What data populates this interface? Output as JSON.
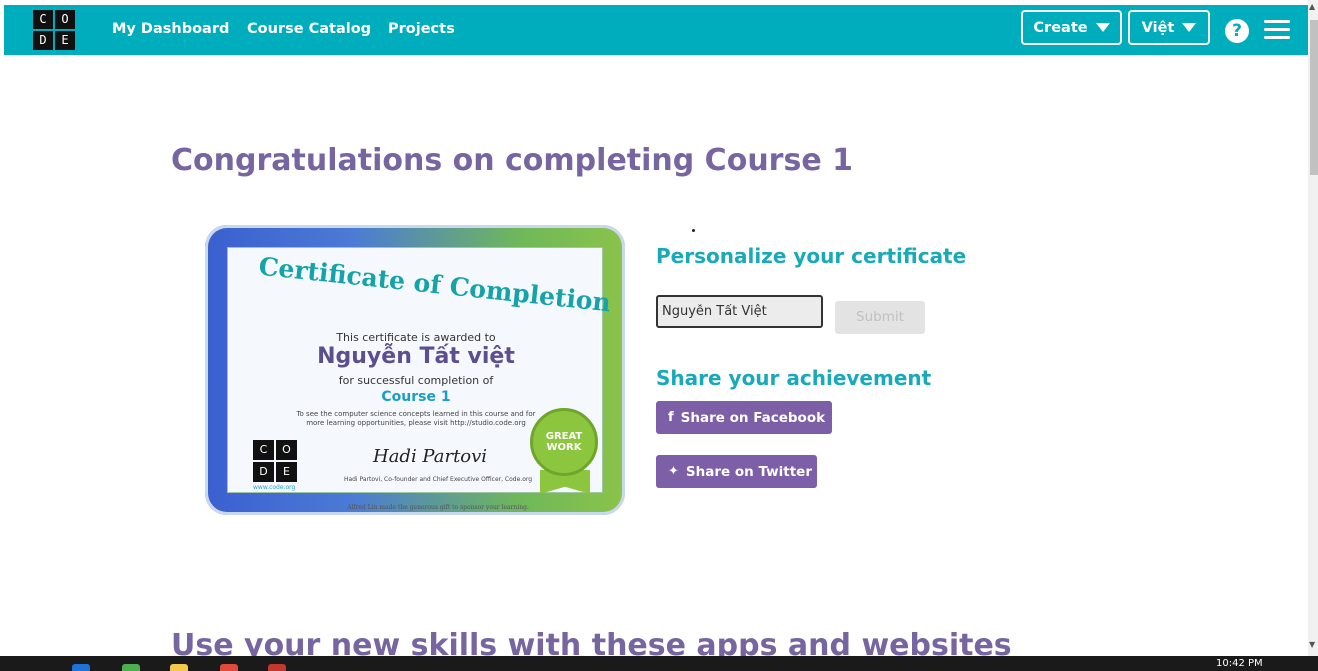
{
  "header": {
    "logo_letters": [
      "C",
      "O",
      "D",
      "E"
    ],
    "nav": [
      "My Dashboard",
      "Course Catalog",
      "Projects"
    ],
    "create_label": "Create",
    "language_label": "Việt",
    "help_glyph": "?"
  },
  "main": {
    "title": "Congratulations on completing Course 1",
    "personalize_title": "Personalize your certificate",
    "name_value": "Nguyễn Tất Việt",
    "submit_label": "Submit",
    "share_title": "Share your achievement",
    "facebook_label": "Share on Facebook",
    "twitter_label": "Share on Twitter",
    "facebook_glyph": "f",
    "twitter_glyph": "✦",
    "bottom_title": "Use your new skills with these apps and websites"
  },
  "certificate": {
    "heading": "Certificate of Completion",
    "awarded_text": "This certificate is awarded to",
    "recipient": "Nguyễn Tất việt",
    "completion_text": "for successful completion of",
    "course": "Course 1",
    "info_text": "To see the computer science concepts learned in this course and for more learning opportunities, please visit http://studio.code.org",
    "url": "www.code.org",
    "signature": "Hadi Partovi",
    "signer": "Hadi Partovi, Co-founder and Chief Executive Officer, Code.org",
    "gift_text": "Alfred Lin made the generous gift to sponsor your learning.",
    "badge_text": "GREAT WORK"
  },
  "taskbar": {
    "time": "10:42 PM"
  },
  "colors": {
    "header_teal": "#00adbc",
    "title_purple": "#7665a0",
    "section_teal": "#19a9b8",
    "share_purple": "#7d5fa8"
  }
}
